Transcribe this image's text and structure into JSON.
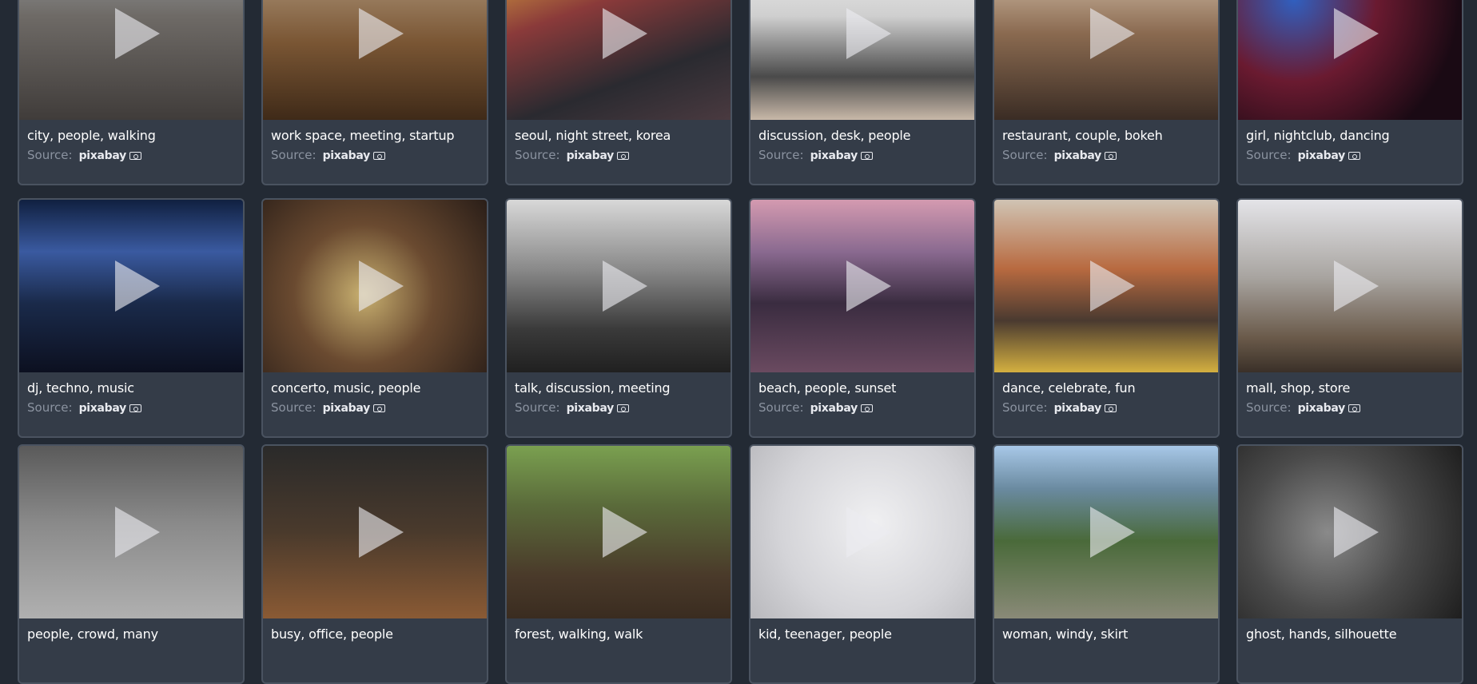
{
  "source_label": "Source:",
  "brand_name": "pixabay",
  "videos": [
    {
      "title": "city, people, walking",
      "thumb": "linear-gradient(180deg,#9aa0a4 0%,#6e6a66 40%,#403c3a 100%)"
    },
    {
      "title": "work space, meeting, startup",
      "thumb": "linear-gradient(180deg,#b9a48a 0%,#7a5634 55%,#3f2a18 100%)"
    },
    {
      "title": "seoul, night street, korea",
      "thumb": "linear-gradient(160deg,#e0b040 0%,#8a3a3a 35%,#2a2a30 70%,#4a3a40 100%)"
    },
    {
      "title": "discussion, desk, people",
      "thumb": "linear-gradient(180deg,#f2f2f2 0%,#cfcfcf 40%,#4a4a4a 75%,#c8b8a8 100%)"
    },
    {
      "title": "restaurant, couple, bokeh",
      "thumb": "linear-gradient(180deg,#e6d6c0 0%,#8a6a50 50%,#3a2c24 100%)"
    },
    {
      "title": "girl, nightclub, dancing",
      "thumb": "radial-gradient(circle at 25% 30%,#3060c0 0%,#6a1a30 40%,#1a0a14 80%)"
    },
    {
      "title": "dj, techno, music",
      "thumb": "linear-gradient(180deg,#102040 0%,#3a5aa0 30%,#1a2a4a 60%,#0c1020 100%)"
    },
    {
      "title": "concerto, music, people",
      "thumb": "radial-gradient(circle at 45% 55%,#c8b070 0%,#6a4a30 45%,#2a1e18 100%)"
    },
    {
      "title": "talk, discussion, meeting",
      "thumb": "linear-gradient(180deg,#d8d8d8 0%,#8a8a8a 40%,#3a3a3a 75%,#202020 100%)"
    },
    {
      "title": "beach, people, sunset",
      "thumb": "linear-gradient(180deg,#d49ab0 0%,#8a6a90 30%,#3a2c40 60%,#6a4a60 100%)"
    },
    {
      "title": "dance, celebrate, fun",
      "thumb": "linear-gradient(180deg,#d0c4b4 0%,#b86a40 40%,#4a3a30 70%,#d4b040 100%)"
    },
    {
      "title": "mall, shop, store",
      "thumb": "linear-gradient(180deg,#e4e4e8 0%,#a8a4a0 45%,#6a5a4a 80%,#3a3028 100%)"
    },
    {
      "title": "people, crowd, many",
      "thumb": "linear-gradient(180deg,#5a5a5a 0%,#8a8a8a 45%,#b0b0b0 100%)"
    },
    {
      "title": "busy, office, people",
      "thumb": "linear-gradient(180deg,#2a2a2a 0%,#4a3a2c 50%,#8a5a34 100%)"
    },
    {
      "title": "forest, walking, walk",
      "thumb": "linear-gradient(180deg,#7aa050 0%,#5a6a3a 35%,#4a3a2a 75%,#3a2c20 100%)"
    },
    {
      "title": "kid, teenager, people",
      "thumb": "radial-gradient(circle at 55% 45%,#f0f0f2 0%,#d4d4d8 60%,#b8b8bc 100%)"
    },
    {
      "title": "woman, windy, skirt",
      "thumb": "linear-gradient(180deg,#a8c8e8 0%,#6a8aa0 25%,#4a6a3a 55%,#8a8a78 100%)"
    },
    {
      "title": "ghost, hands, silhouette",
      "thumb": "radial-gradient(circle at 40% 50%,#8a8a8a 0%,#4a4a4a 50%,#1e1e1e 100%)"
    }
  ]
}
